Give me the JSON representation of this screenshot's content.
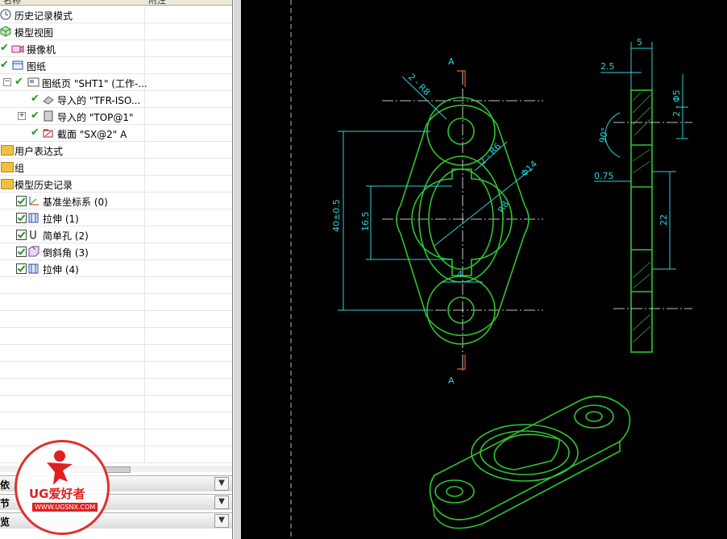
{
  "navigator": {
    "col_name": "名称",
    "col_note": "附注",
    "rows": [
      {
        "label": "历史记录模式"
      },
      {
        "label": "模型视图"
      },
      {
        "label": "摄像机"
      },
      {
        "label": "图纸"
      },
      {
        "label": "图纸页 \"SHT1\" (工作-..."
      },
      {
        "label": "导入的 \"TFR-ISO..."
      },
      {
        "label": "导入的 \"TOP@1\""
      },
      {
        "label": "截面 \"SX@2\" A"
      },
      {
        "label": "用户表达式"
      },
      {
        "label": "组"
      },
      {
        "label": "模型历史记录"
      },
      {
        "label": "基准坐标系 (0)"
      },
      {
        "label": "拉伸 (1)"
      },
      {
        "label": "简单孔 (2)"
      },
      {
        "label": "倒斜角 (3)"
      },
      {
        "label": "拉伸 (4)"
      }
    ],
    "sections": [
      {
        "label": "依"
      },
      {
        "label": "节"
      },
      {
        "label": "览"
      }
    ]
  },
  "drawing": {
    "section_label_top": "A",
    "section_label_bottom": "A",
    "dims": {
      "hole_r8": "2 - R8",
      "hole_r6": "2 - R6",
      "dia14": "Φ14",
      "r8": "R8",
      "h40": "40±0.5",
      "h16": "16.5",
      "w4": "4",
      "w5": "5",
      "d25": "2.5",
      "d5": "2 - Φ5",
      "ang90": "90°",
      "d075": "0.75",
      "h22": "22"
    }
  },
  "logo": {
    "brand": "UG爱好者",
    "url": "WWW.UGSNX.COM"
  },
  "colors": {
    "geometry": "#2ec52e",
    "dimension": "#2ad2d8",
    "background": "#000000"
  }
}
